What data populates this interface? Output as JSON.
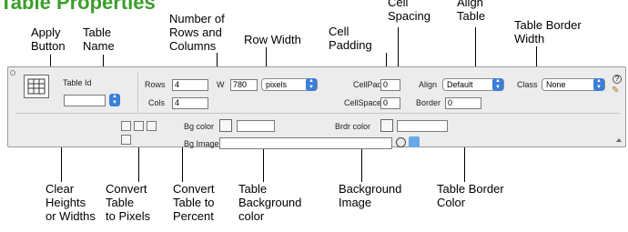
{
  "title": "Table Properties",
  "callouts": {
    "apply_button": "Apply\nButton",
    "table_name": "Table\nName",
    "rows_columns": "Number of\nRows and\nColumns",
    "row_width": "Row Width",
    "cell_padding": "Cell\nPadding",
    "cell_spacing": "Cell\nSpacing",
    "align_table": "Align\nTable",
    "border_width": "Table Border\nWidth",
    "clear_heights": "Clear\nHeights\nor Widths",
    "convert_pixels": "Convert\nTable\nto Pixels",
    "convert_percent": "Convert\nTable to\nPercent",
    "bg_color": "Table\nBackground\ncolor",
    "bg_image": "Background\nImage",
    "border_color": "Table Border\nColor"
  },
  "panel": {
    "table_id_label": "Table Id",
    "table_id_value": "",
    "rows_label": "Rows",
    "rows_value": "4",
    "cols_label": "Cols",
    "cols_value": "4",
    "width_label": "W",
    "width_value": "780",
    "width_unit": "pixels",
    "cellpad_label": "CellPad",
    "cellpad_value": "0",
    "cellspace_label": "CellSpace",
    "cellspace_value": "0",
    "align_label": "Align",
    "align_value": "Default",
    "border_label": "Border",
    "border_value": "0",
    "class_label": "Class",
    "class_value": "None",
    "bg_color_label": "Bg color",
    "bg_image_label": "Bg Image",
    "brdr_color_label": "Brdr color",
    "bg_image_value": "",
    "help_icon": "?"
  },
  "colors": {
    "title": "#3a9e2a",
    "stepper": "#3b7fd9"
  }
}
